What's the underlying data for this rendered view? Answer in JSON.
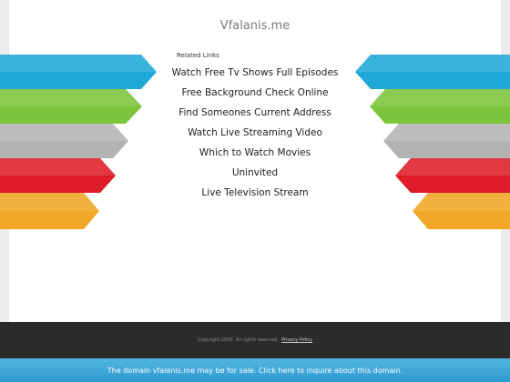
{
  "site": {
    "title": "Vfalanis.me"
  },
  "related": {
    "label": "Related Links",
    "links": [
      "Watch Free Tv Shows Full Episodes",
      "Free Background Check Online",
      "Find Someones Current Address",
      "Watch Live Streaming Video",
      "Which to Watch Movies",
      "Uninvited",
      "Live Television Stream"
    ]
  },
  "arrows": {
    "colors": [
      "#1fa9d8",
      "#7cc43b",
      "#b2b2b2",
      "#de1d28",
      "#f0a826"
    ]
  },
  "footer": {
    "copyright": "Copyright 2020. All rights reserved.",
    "privacy": "Privacy Policy"
  },
  "sale_bar": {
    "text": "The domain vfalanis.me may be for sale. Click here to inquire about this domain."
  }
}
